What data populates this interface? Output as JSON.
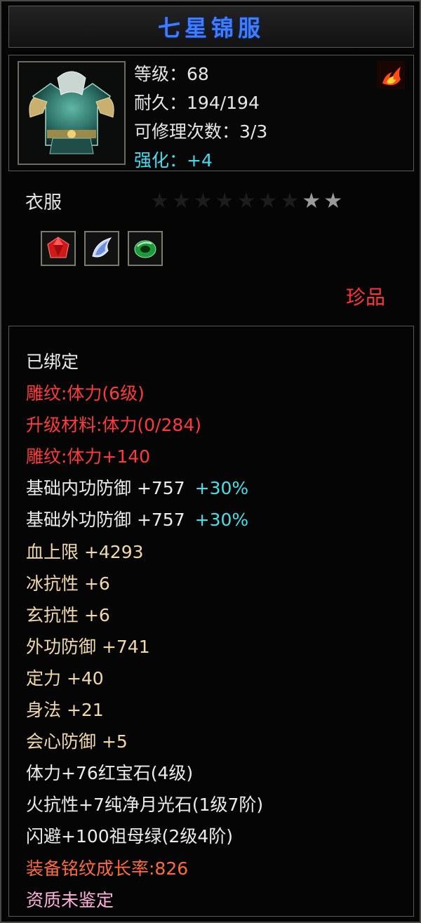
{
  "item": {
    "name": "七星锦服",
    "level_line": "等级：68",
    "durability_line": "耐久：194/194",
    "repair_line": "可修理次数：3/3",
    "enhance_label": "强化：",
    "enhance_value": "+4",
    "type": "衣服",
    "quality": "珍品"
  },
  "stars": {
    "total": 9,
    "lit": 2
  },
  "gems": [
    {
      "icon": "red-ruby-gem-icon"
    },
    {
      "icon": "moonstone-gem-icon"
    },
    {
      "icon": "emerald-gem-icon"
    }
  ],
  "attributes": [
    {
      "text": "已绑定",
      "color": "white"
    },
    {
      "text": "雕纹:体力(6级)",
      "color": "red"
    },
    {
      "text": "升级材料:体力(0/284)",
      "color": "red"
    },
    {
      "text": "雕纹:体力+140",
      "color": "red"
    },
    {
      "text": "基础内功防御 +757",
      "bonus": "+30%",
      "color": "white"
    },
    {
      "text": "基础外功防御 +757",
      "bonus": "+30%",
      "color": "white"
    },
    {
      "text": "血上限 +4293",
      "color": "gold"
    },
    {
      "text": "冰抗性 +6",
      "color": "gold"
    },
    {
      "text": "玄抗性 +6",
      "color": "gold"
    },
    {
      "text": "外功防御 +741",
      "color": "gold"
    },
    {
      "text": "定力 +40",
      "color": "gold"
    },
    {
      "text": "身法 +21",
      "color": "gold"
    },
    {
      "text": "会心防御 +5",
      "color": "gold"
    },
    {
      "text": "体力+76红宝石(4级)",
      "color": "white"
    },
    {
      "text": "火抗性+7纯净月光石(1级7阶)",
      "color": "white"
    },
    {
      "text": "闪避+100祖母绿(2级4阶)",
      "color": "white"
    },
    {
      "text": "装备铭纹成长率:826",
      "color": "orange"
    },
    {
      "text": "资质未鉴定",
      "color": "pink"
    }
  ],
  "colors": {
    "title": "#3f7dff",
    "white": "#ececec",
    "red": "#ff3a3a",
    "gold": "#f2d9a8",
    "orange": "#ff6a3a",
    "pink": "#ffb0dc",
    "cyan": "#43e1ea"
  }
}
